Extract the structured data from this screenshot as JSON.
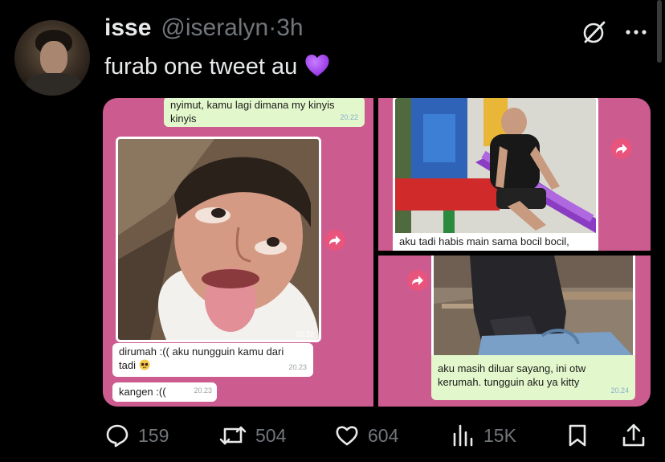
{
  "tweet": {
    "author_name": "isse",
    "author_handle": "@iseralyn",
    "separator": "·",
    "time": "3h",
    "text": "furab one tweet au",
    "emoji": "purple-heart"
  },
  "media": {
    "panel_left": {
      "top_bubble_line1": "nyimut, kamu lagi dimana my kinyis",
      "top_bubble_line2": "kinyis",
      "top_bubble_time": "20.22",
      "photo_time": "20.22",
      "bubble2_line1": "dirumah :(( aku nungguin kamu dari",
      "bubble2_line2": "tadi",
      "bubble2_time": "20.23",
      "bubble3_text": "kangen :((",
      "bubble3_time": "20.23"
    },
    "panel_top_right": {
      "caption": "aku tadi habis main sama bocil bocil,"
    },
    "panel_bottom_right": {
      "caption_line1": "aku masih diluar sayang, ini otw",
      "caption_line2": "kerumah. tungguin aku ya kitty",
      "time": "20.24"
    }
  },
  "actions": {
    "replies": "159",
    "reposts": "504",
    "likes": "604",
    "views": "15K"
  },
  "colors": {
    "background": "#000000",
    "muted": "#71767b",
    "chat_pink": "#cc5b8f",
    "bubble_green": "#e2f7cb"
  }
}
